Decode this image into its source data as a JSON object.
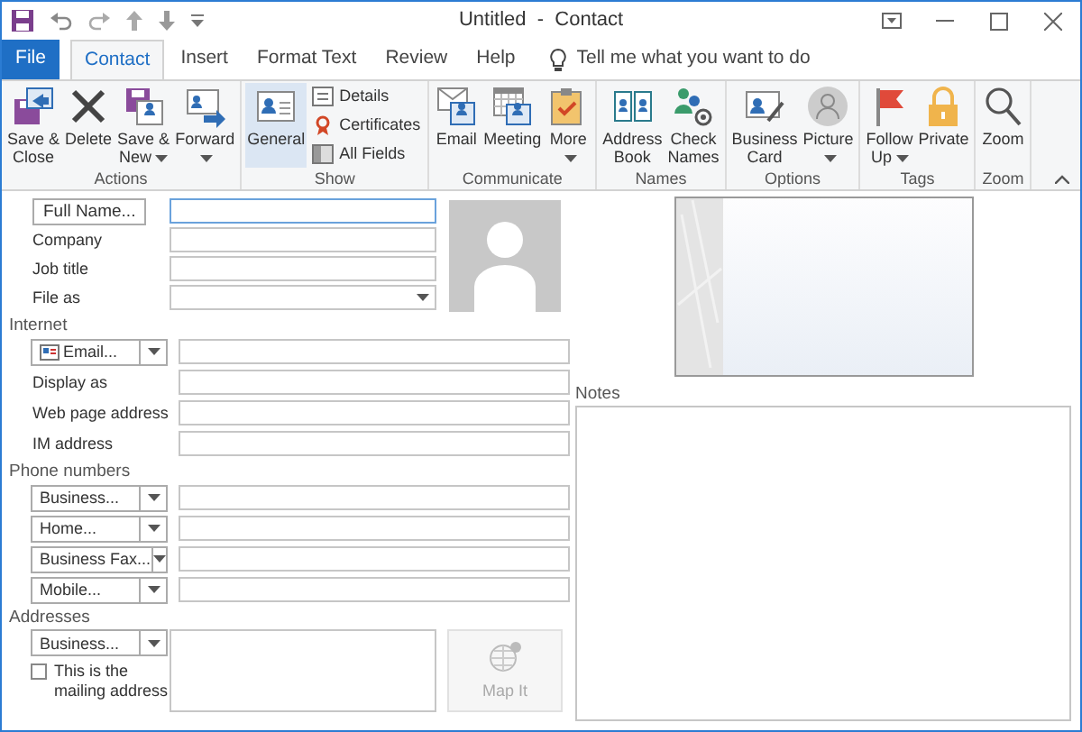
{
  "window": {
    "title": "Untitled  -  Contact"
  },
  "tabs": [
    {
      "label": "File",
      "kind": "file",
      "selected": false
    },
    {
      "label": "Contact",
      "kind": "tab",
      "selected": true
    },
    {
      "label": "Insert",
      "kind": "tab",
      "selected": false
    },
    {
      "label": "Format Text",
      "kind": "tab",
      "selected": false
    },
    {
      "label": "Review",
      "kind": "tab",
      "selected": false
    },
    {
      "label": "Help",
      "kind": "tab",
      "selected": false
    }
  ],
  "tell_me": "Tell me what you want to do",
  "groups": [
    {
      "label": "Actions",
      "buttons": [
        {
          "label": "Save &\nClose",
          "kind": "large",
          "menu": false,
          "selected": false
        },
        {
          "label": "Delete",
          "kind": "large",
          "menu": false,
          "selected": false
        },
        {
          "label": "Save &\nNew",
          "kind": "large",
          "menu": true,
          "selected": false
        },
        {
          "label": "Forward\n",
          "kind": "large",
          "menu": true,
          "selected": false
        }
      ]
    },
    {
      "label": "Show",
      "buttons": [
        {
          "label": "General",
          "kind": "large",
          "menu": false,
          "selected": true
        },
        {
          "label": "Details",
          "kind": "small",
          "menu": false,
          "selected": false
        },
        {
          "label": "Certificates",
          "kind": "small",
          "menu": false,
          "selected": false
        },
        {
          "label": "All Fields",
          "kind": "small",
          "menu": false,
          "selected": false
        }
      ]
    },
    {
      "label": "Communicate",
      "buttons": [
        {
          "label": "Email",
          "kind": "large",
          "menu": false,
          "selected": false
        },
        {
          "label": "Meeting",
          "kind": "large",
          "menu": false,
          "selected": false
        },
        {
          "label": "More\n",
          "kind": "large",
          "menu": true,
          "selected": false
        }
      ]
    },
    {
      "label": "Names",
      "buttons": [
        {
          "label": "Address\nBook",
          "kind": "large",
          "menu": false,
          "selected": false
        },
        {
          "label": "Check\nNames",
          "kind": "large",
          "menu": false,
          "selected": false
        }
      ]
    },
    {
      "label": "Options",
      "buttons": [
        {
          "label": "Business\nCard",
          "kind": "large",
          "menu": false,
          "selected": false
        },
        {
          "label": "Picture\n",
          "kind": "large",
          "menu": true,
          "selected": false
        }
      ]
    },
    {
      "label": "Tags",
      "buttons": [
        {
          "label": "Follow\nUp",
          "kind": "large",
          "menu": true,
          "selected": false
        },
        {
          "label": "Private",
          "kind": "large",
          "menu": false,
          "selected": false
        }
      ]
    },
    {
      "label": "Zoom",
      "buttons": [
        {
          "label": "Zoom",
          "kind": "large",
          "menu": false,
          "selected": false
        }
      ]
    }
  ],
  "name_rows": [
    {
      "label": "Full Name...",
      "kind": "button",
      "dropdown": false,
      "focused": true
    },
    {
      "label": "Company",
      "kind": "label",
      "dropdown": false,
      "focused": false
    },
    {
      "label": "Job title",
      "kind": "label",
      "dropdown": false,
      "focused": false
    },
    {
      "label": "File as",
      "kind": "label",
      "dropdown": true,
      "focused": false
    }
  ],
  "sections": [
    {
      "title": "Internet",
      "rows": [
        {
          "label": "Email...",
          "kind": "split"
        },
        {
          "label": "Display as",
          "kind": "label"
        },
        {
          "label": "Web page address",
          "kind": "label"
        },
        {
          "label": "IM address",
          "kind": "label"
        }
      ]
    },
    {
      "title": "Phone numbers",
      "rows": [
        {
          "label": "Business...",
          "kind": "split"
        },
        {
          "label": "Home...",
          "kind": "split"
        },
        {
          "label": "Business Fax...",
          "kind": "split"
        },
        {
          "label": "Mobile...",
          "kind": "split"
        }
      ]
    }
  ],
  "addresses": {
    "title": "Addresses",
    "type": "Business...",
    "mailing": {
      "label": "This is the mailing address",
      "checked": false
    },
    "map_button": {
      "label": "Map It",
      "disabled": true
    }
  },
  "notes": {
    "label": "Notes"
  }
}
